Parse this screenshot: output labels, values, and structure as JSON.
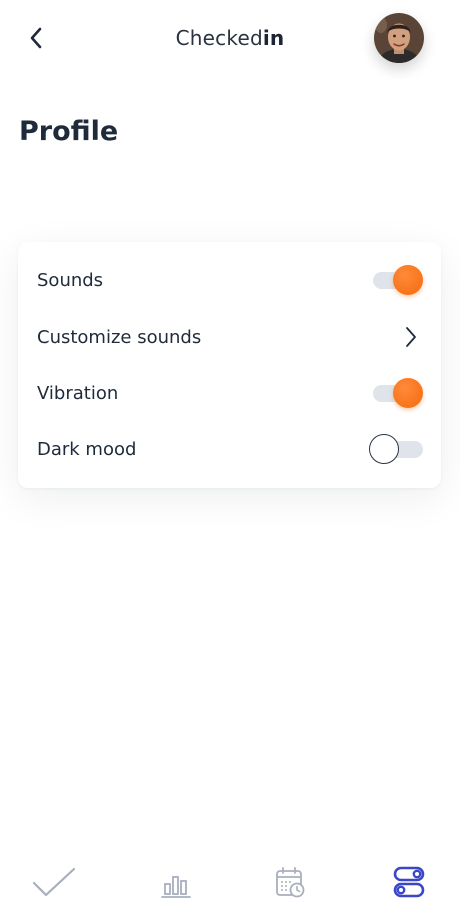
{
  "header": {
    "brand_light": "Checked",
    "brand_bold": "in",
    "back_icon": "chevron-left-icon",
    "avatar_icon": "user-avatar"
  },
  "page": {
    "title": "Profile"
  },
  "settings": {
    "rows": [
      {
        "label": "Sounds",
        "control": "toggle",
        "state": "on"
      },
      {
        "label": "Customize sounds",
        "control": "chevron",
        "icon": "chevron-right-icon"
      },
      {
        "label": "Vibration",
        "control": "toggle",
        "state": "on"
      },
      {
        "label": "Dark mood",
        "control": "toggle",
        "state": "off"
      }
    ]
  },
  "tabbar": {
    "tabs": [
      {
        "icon": "check-icon",
        "active": false
      },
      {
        "icon": "bar-chart-icon",
        "active": false
      },
      {
        "icon": "calendar-clock-icon",
        "active": false
      },
      {
        "icon": "toggles-icon",
        "active": true
      }
    ]
  },
  "colors": {
    "accent_orange": "#f46a0c",
    "active_tab": "#3b47c9",
    "inactive_tab": "#a8afbd",
    "text_dark": "#1f2b3a",
    "toggle_track": "#dfe3ea"
  }
}
